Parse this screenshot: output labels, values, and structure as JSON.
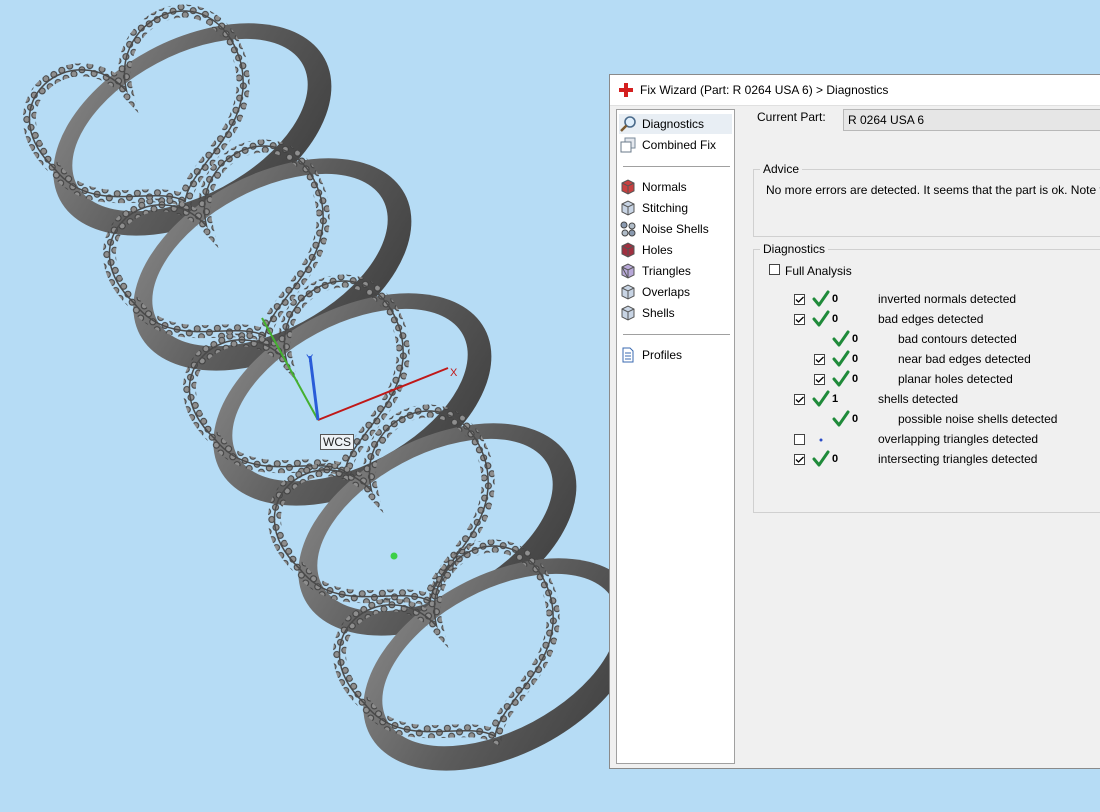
{
  "viewport": {
    "wcs_label": "WCS",
    "axes": {
      "x": "X",
      "y": "Y"
    }
  },
  "wizard": {
    "title": "Fix Wizard (Part: R 0264 USA 6) > Diagnostics",
    "nav": {
      "group1": [
        {
          "label": "Diagnostics",
          "icon": "magnifier-icon",
          "selected": true
        },
        {
          "label": "Combined Fix",
          "icon": "combined-fix-icon"
        }
      ],
      "group2": [
        {
          "label": "Normals",
          "icon": "normals-cube-icon"
        },
        {
          "label": "Stitching",
          "icon": "stitching-cube-icon"
        },
        {
          "label": "Noise Shells",
          "icon": "noise-shells-icon"
        },
        {
          "label": "Holes",
          "icon": "holes-cube-icon"
        },
        {
          "label": "Triangles",
          "icon": "triangles-cube-icon"
        },
        {
          "label": "Overlaps",
          "icon": "overlaps-cube-icon"
        },
        {
          "label": "Shells",
          "icon": "shells-cube-icon"
        }
      ],
      "group3": [
        {
          "label": "Profiles",
          "icon": "profiles-document-icon"
        }
      ]
    },
    "current_part_label": "Current Part:",
    "current_part_value": "R 0264 USA 6",
    "advice": {
      "title": "Advice",
      "text": "No more errors are detected. It seems that the part is ok. Note that"
    },
    "diagnostics": {
      "title": "Diagnostics",
      "full_analysis_label": "Full Analysis",
      "full_analysis_checked": false,
      "rows": [
        {
          "checkbox": true,
          "checked": true,
          "status": "ok",
          "count": "0",
          "label": "inverted normals detected",
          "indent": 0
        },
        {
          "checkbox": true,
          "checked": true,
          "status": "ok",
          "count": "0",
          "label": "bad edges detected",
          "indent": 0
        },
        {
          "checkbox": false,
          "checked": false,
          "status": "ok",
          "count": "0",
          "label": "bad contours detected",
          "indent": 1
        },
        {
          "checkbox": true,
          "checked": true,
          "status": "ok",
          "count": "0",
          "label": "near bad edges detected",
          "indent": 1
        },
        {
          "checkbox": true,
          "checked": true,
          "status": "ok",
          "count": "0",
          "label": "planar holes detected",
          "indent": 1
        },
        {
          "checkbox": true,
          "checked": true,
          "status": "ok",
          "count": "1",
          "label": "shells detected",
          "indent": 0
        },
        {
          "checkbox": false,
          "checked": false,
          "status": "ok",
          "count": "0",
          "label": "possible noise shells detected",
          "indent": 1
        },
        {
          "checkbox": true,
          "checked": false,
          "status": "pending",
          "count": "",
          "label": "overlapping triangles detected",
          "indent": 0
        },
        {
          "checkbox": true,
          "checked": true,
          "status": "ok",
          "count": "0",
          "label": "intersecting triangles detected",
          "indent": 0
        }
      ]
    },
    "colors": {
      "background": "#b6dcf5",
      "check_green": "#1f8a3a",
      "title_icon_red": "#d42020"
    }
  }
}
